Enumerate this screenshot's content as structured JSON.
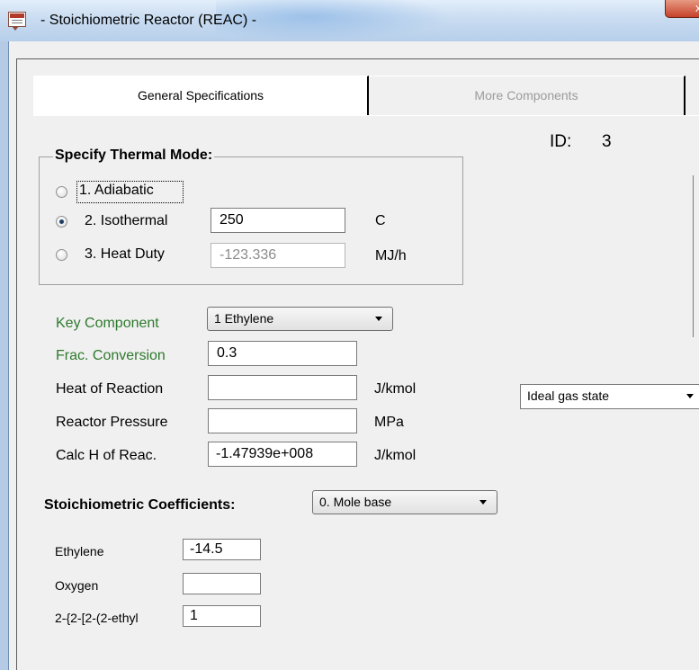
{
  "window": {
    "title": "- Stoichiometric Reactor (REAC) -",
    "close_glyph": "x"
  },
  "tabs": [
    {
      "label": "General Specifications",
      "active": true
    },
    {
      "label": "More Components",
      "active": false
    }
  ],
  "id_label": "ID:",
  "id_value": "3",
  "thermal_mode": {
    "legend": "Specify Thermal Mode:",
    "options": [
      {
        "label": "1. Adiabatic",
        "selected": false
      },
      {
        "label": "2. Isothermal",
        "selected": true,
        "value": "250",
        "unit": "C"
      },
      {
        "label": "3. Heat Duty",
        "selected": false,
        "value": "-123.336",
        "unit": "MJ/h"
      }
    ]
  },
  "key_component": {
    "label": "Key Component",
    "selected": "1 Ethylene"
  },
  "frac_conversion": {
    "label": "Frac. Conversion",
    "value": "0.3"
  },
  "heat_of_reaction": {
    "label": "Heat of Reaction",
    "value": "",
    "unit": "J/kmol",
    "state_selected": "Ideal gas state"
  },
  "reactor_pressure": {
    "label": "Reactor Pressure",
    "value": "",
    "unit": "MPa"
  },
  "calc_h": {
    "label": "Calc H of Reac.",
    "value": "-1.47939e+008",
    "unit": "J/kmol"
  },
  "stoich": {
    "label": "Stoichiometric Coefficients:",
    "basis_selected": "0. Mole base",
    "components": [
      {
        "name": "Ethylene",
        "value": "-14.5"
      },
      {
        "name": "Oxygen",
        "value": ""
      },
      {
        "name": "2-{2-[2-(2-ethyl",
        "value": "1"
      }
    ]
  },
  "colors": {
    "green_label": "#2e7a2e",
    "disabled_text": "#8c8c8c",
    "close_button": "#c5412a"
  }
}
